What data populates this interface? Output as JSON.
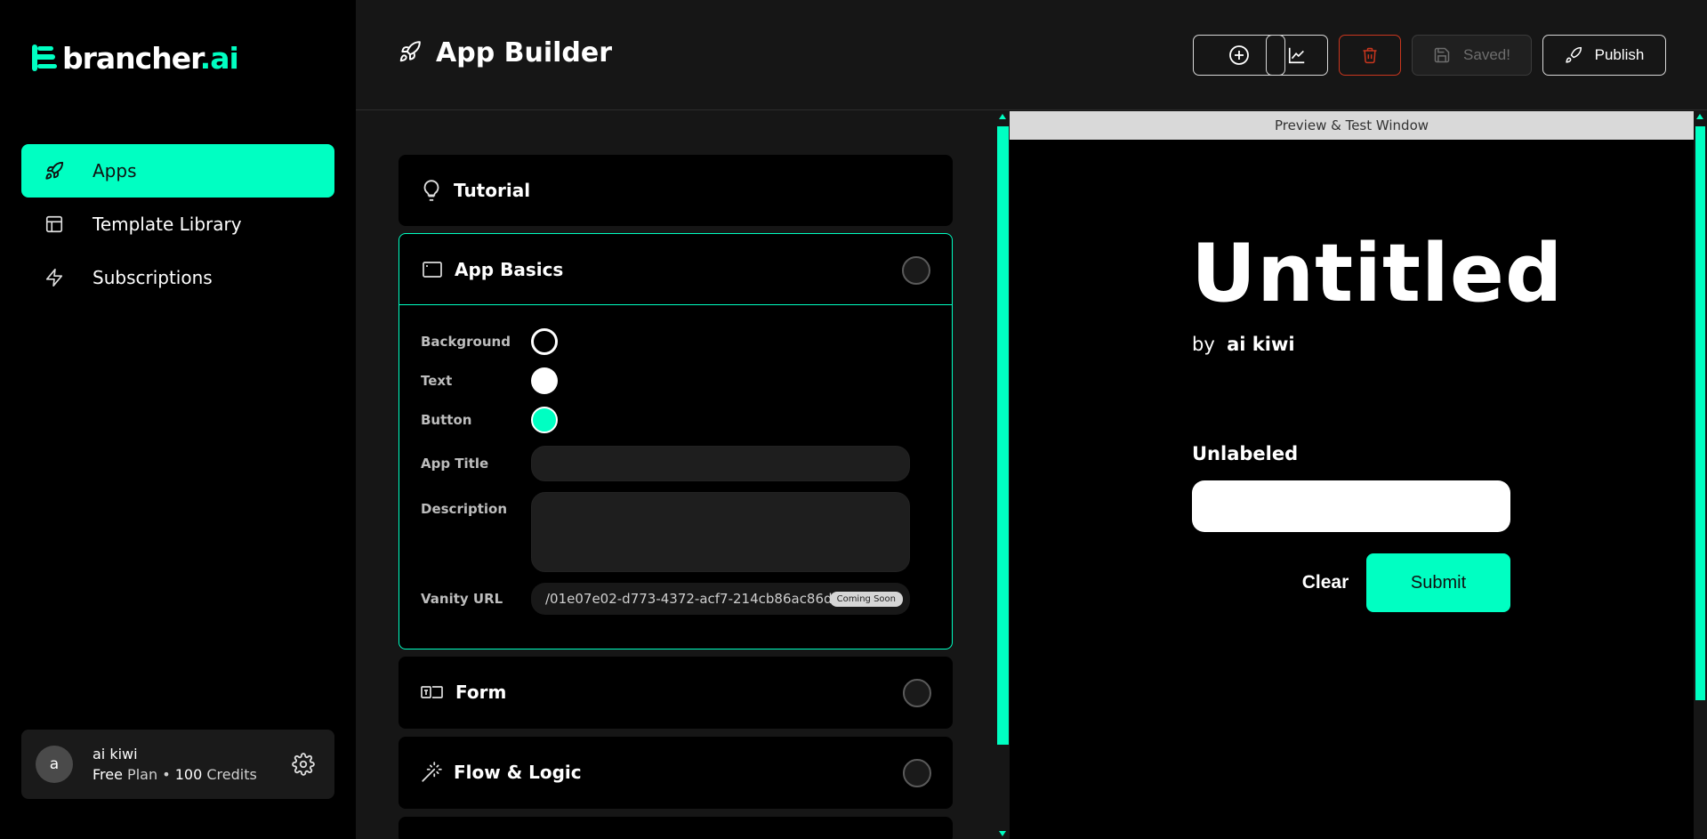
{
  "brand": {
    "name": "brancher",
    "suffix": ".ai",
    "accent": "#00ffc2"
  },
  "sidebar": {
    "items": [
      {
        "label": "Apps",
        "icon": "rocket-icon",
        "active": true
      },
      {
        "label": "Template Library",
        "icon": "layout-icon",
        "active": false
      },
      {
        "label": "Subscriptions",
        "icon": "lightning-icon",
        "active": false
      }
    ]
  },
  "user": {
    "avatar_letter": "a",
    "name": "ai kiwi",
    "plan": "Free",
    "plan_word": "Plan",
    "separator": "•",
    "credits": "100",
    "credits_word": "Credits"
  },
  "header": {
    "title": "App Builder",
    "buttons": {
      "add": "plus-circle-icon",
      "analytics": "chart-icon",
      "delete": "trash-icon",
      "saved_label": "Saved!",
      "publish_label": "Publish"
    }
  },
  "editor": {
    "tutorial": {
      "title": "Tutorial"
    },
    "app_basics": {
      "title": "App Basics",
      "background_label": "Background",
      "text_label": "Text",
      "button_label": "Button",
      "app_title_label": "App Title",
      "app_title_value": "",
      "description_label": "Description",
      "description_value": "",
      "vanity_label": "Vanity URL",
      "vanity_value": "/01e07e02-d773-4372-acf7-214cb86ac86d",
      "coming_soon": "Coming Soon",
      "colors": {
        "background": "#000000",
        "text": "#ffffff",
        "button": "#00ffc2"
      }
    },
    "form": {
      "title": "Form"
    },
    "flow": {
      "title": "Flow & Logic"
    }
  },
  "preview": {
    "bar_label": "Preview & Test Window",
    "title": "Untitled",
    "by_word": "by",
    "author": "ai kiwi",
    "field_label": "Unlabeled",
    "clear_label": "Clear",
    "submit_label": "Submit"
  }
}
